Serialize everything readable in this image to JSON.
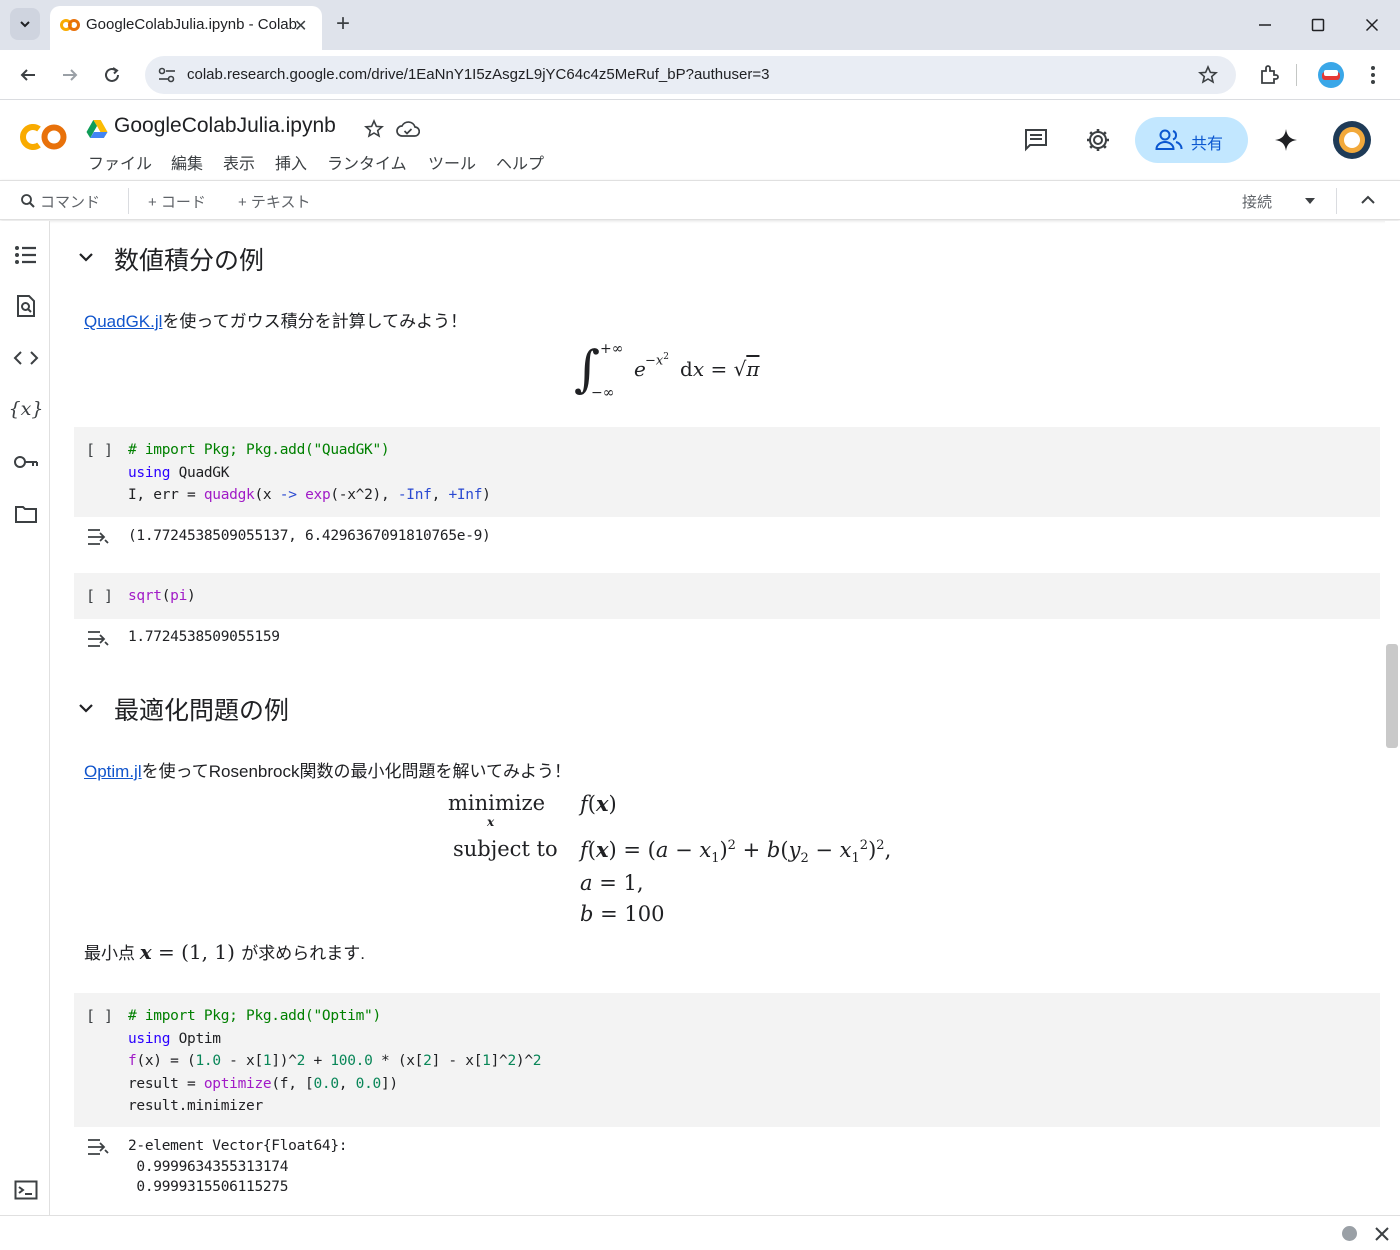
{
  "browser": {
    "tab_title": "GoogleColabJulia.ipynb - Colab",
    "tab_close": "✕",
    "new_tab": "+",
    "url": "colab.research.google.com/drive/1EaNnY1I5zAsgzL9jYC64c4z5MeRuf_bP?authuser=3"
  },
  "colab": {
    "logo": "CO",
    "notebook_title": "GoogleColabJulia.ipynb",
    "menu": [
      "ファイル",
      "編集",
      "表示",
      "挿入",
      "ランタイム",
      "ツール",
      "ヘルプ"
    ],
    "share_label": "共有",
    "toolbar": {
      "command": "コマンド",
      "add_code": "+ コード",
      "add_text": "+ テキスト",
      "connect": "接続"
    }
  },
  "sections": [
    {
      "title": "数値積分の例",
      "intro_link": "QuadGK.jl",
      "intro_text": "を使ってガウス積分を計算してみよう！",
      "cell_bracket": "[ ]",
      "output": "(1.7724538509055137, 6.4296367091810765e-9)",
      "cell2_output": "1.7724538509055159"
    },
    {
      "title": "最適化問題の例",
      "intro_link": "Optim.jl",
      "intro_text": "を使ってRosenbrock関数の最小化問題を解いてみよう！",
      "math_minimize": "minimize",
      "math_subject_to": "subject to",
      "result_prefix": "最小点",
      "result_suffix": "が求められます.",
      "output_lines": [
        "2-element Vector{Float64}:",
        " 0.9999634355313174",
        " 0.9999315506115275"
      ]
    }
  ],
  "colors": {
    "accent": "#c2e7ff",
    "link": "#1155cc",
    "code_bg": "#f3f3f3"
  }
}
